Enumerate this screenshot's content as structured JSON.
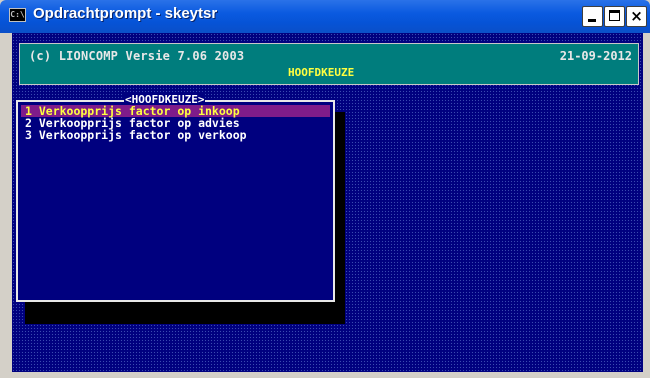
{
  "window": {
    "title": "Opdrachtprompt - skeytsr",
    "icon": "cmd-window-icon",
    "icon_glyph": "C:\\",
    "close_glyph": "×"
  },
  "header": {
    "copyright": "(c) LIONCOMP Versie 7.06 2003",
    "date": "21-09-2012",
    "menu_title": "HOOFDKEUZE"
  },
  "menu": {
    "box_title": "<HOOFDKEUZE>",
    "items": [
      {
        "label": "1 Verkoopprijs factor op inkoop",
        "selected": true
      },
      {
        "label": "2 Verkoopprijs factor op advies",
        "selected": false
      },
      {
        "label": "3 Verkoopprijs factor op verkoop",
        "selected": false
      }
    ]
  },
  "colors": {
    "console_bg": "#00007f",
    "header_bg": "#007d7d",
    "highlight_bg": "#7f1c8a",
    "highlight_text": "#ffff40",
    "titlebar": "#0a5ae0"
  }
}
